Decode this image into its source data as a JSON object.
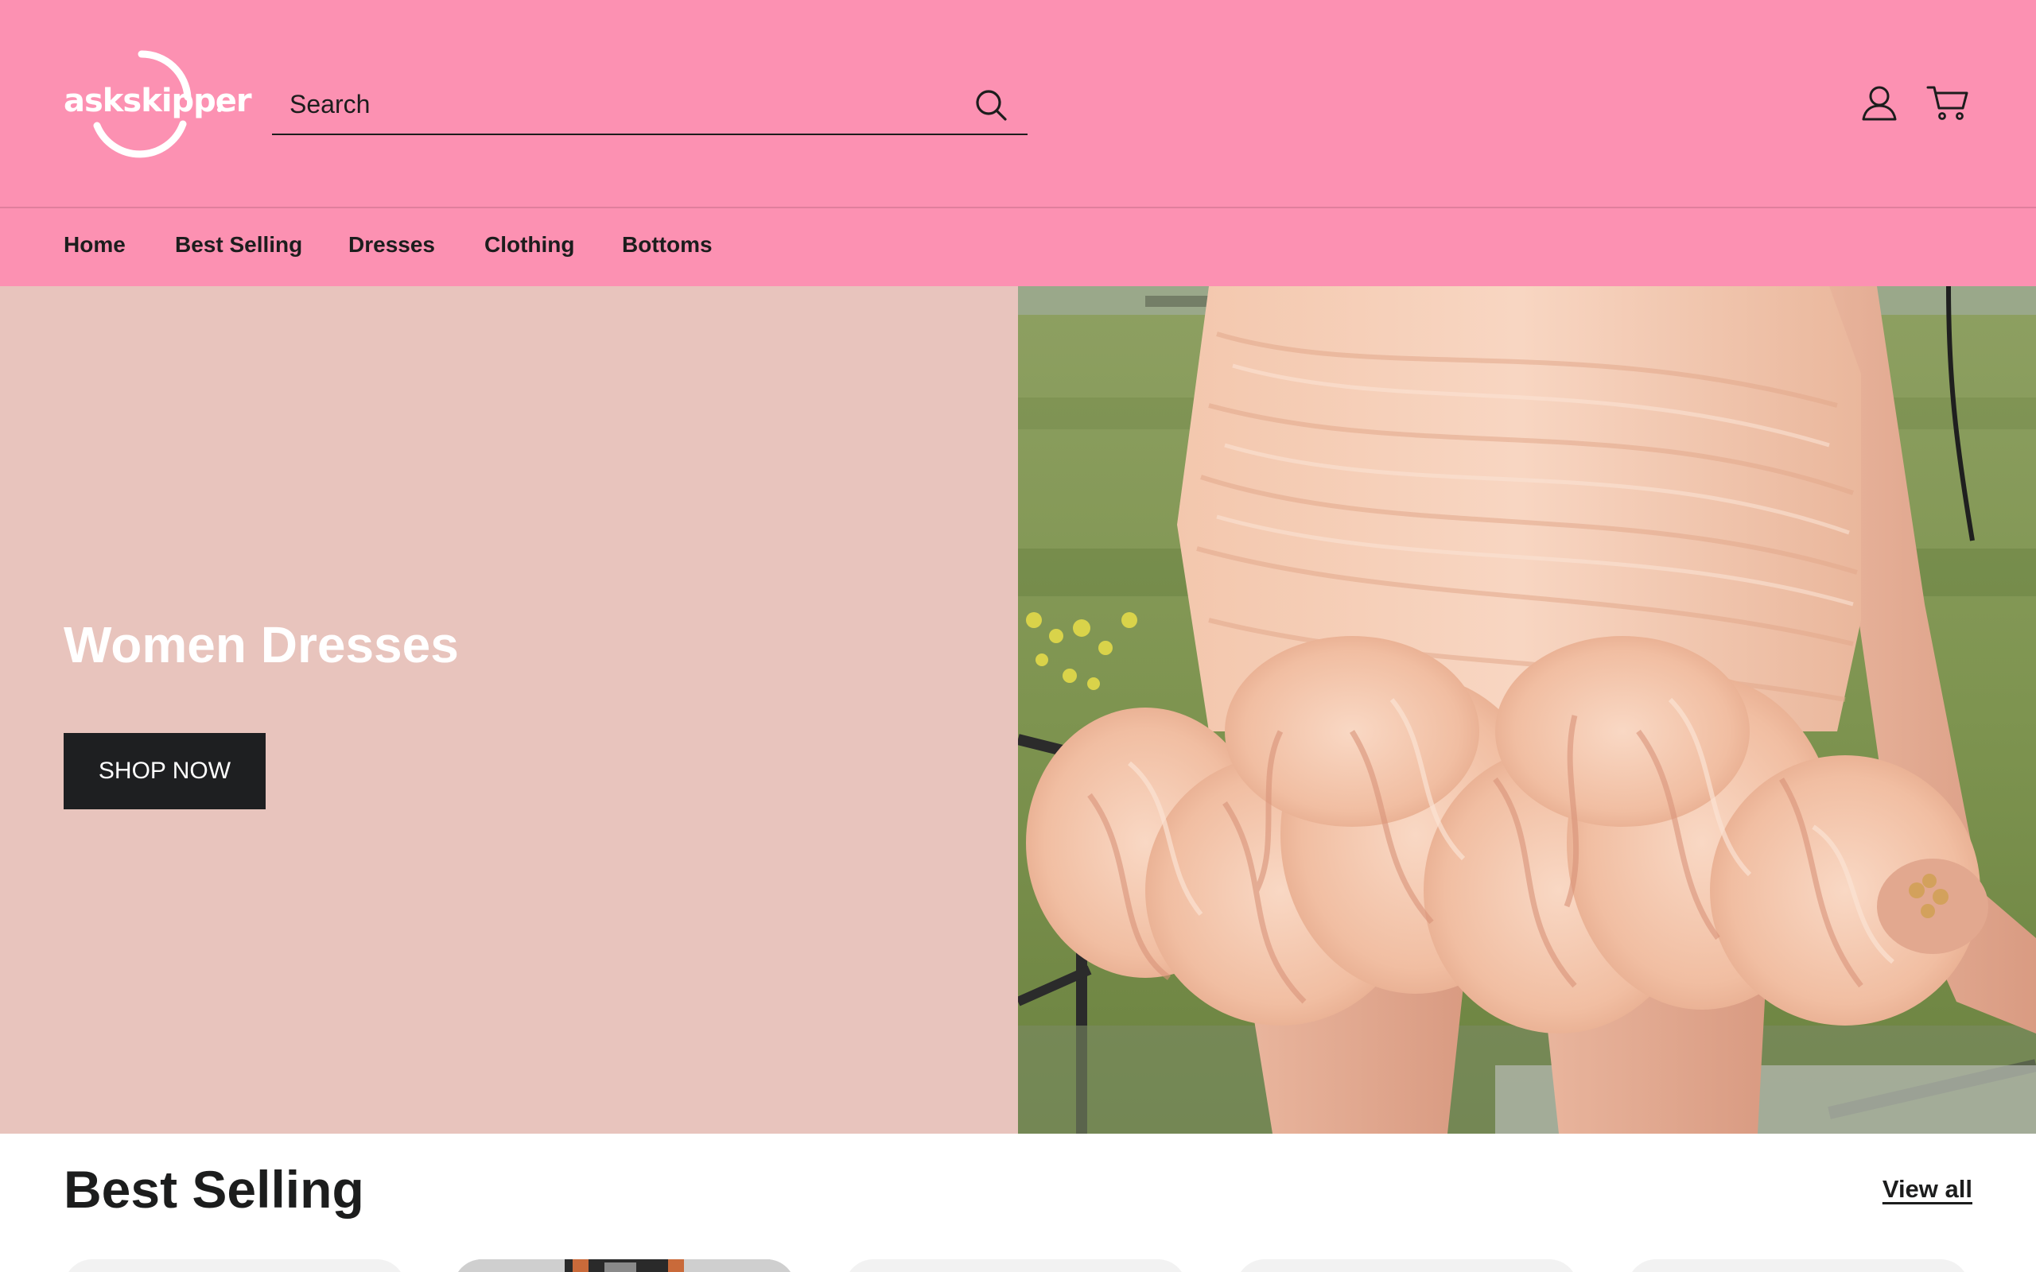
{
  "header": {
    "logo_text": "askskipper",
    "search": {
      "placeholder": "Search",
      "value": ""
    },
    "background_color": "#fc91b2"
  },
  "nav": {
    "items": [
      {
        "label": "Home"
      },
      {
        "label": "Best Selling"
      },
      {
        "label": "Dresses"
      },
      {
        "label": "Clothing"
      },
      {
        "label": "Bottoms"
      }
    ]
  },
  "hero": {
    "title": "Women Dresses",
    "button_label": "SHOP NOW",
    "left_background_color": "#e8c4bd",
    "image_subject": "peach ruffled mini dress"
  },
  "best_selling": {
    "title": "Best Selling",
    "view_all_label": "View all"
  },
  "icons": [
    "search-icon",
    "account-icon",
    "cart-icon"
  ]
}
